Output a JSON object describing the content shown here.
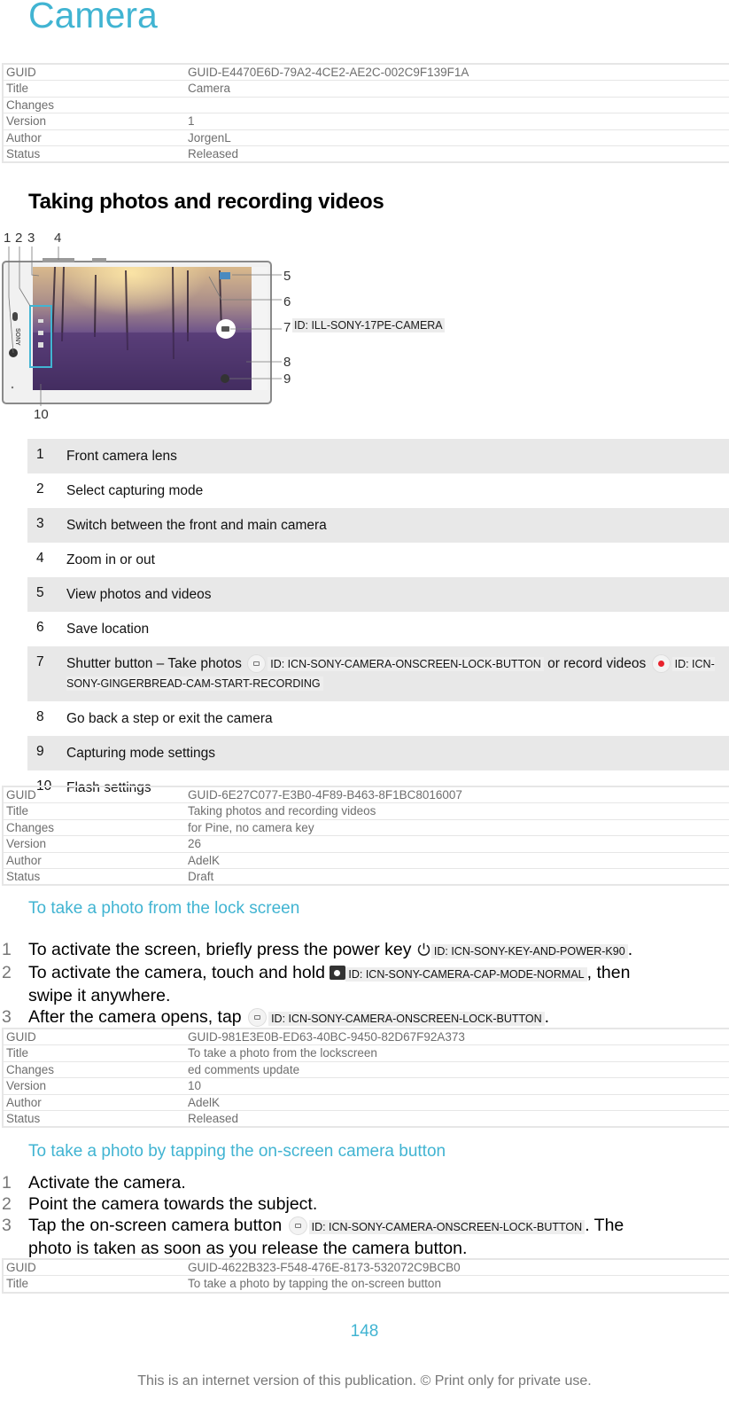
{
  "page_title": "Camera",
  "meta_tables": [
    {
      "rows": [
        {
          "key": "GUID",
          "value": "GUID-E4470E6D-79A2-4CE2-AE2C-002C9F139F1A"
        },
        {
          "key": "Title",
          "value": "Camera"
        },
        {
          "key": "Changes",
          "value": ""
        },
        {
          "key": "Version",
          "value": "1"
        },
        {
          "key": "Author",
          "value": "JorgenL"
        },
        {
          "key": "Status",
          "value": "Released"
        }
      ]
    },
    {
      "rows": [
        {
          "key": "GUID",
          "value": "GUID-6E27C077-E3B0-4F89-B463-8F1BC8016007"
        },
        {
          "key": "Title",
          "value": "Taking photos and recording videos"
        },
        {
          "key": "Changes",
          "value": "for Pine, no camera key"
        },
        {
          "key": "Version",
          "value": "26"
        },
        {
          "key": "Author",
          "value": "AdelK"
        },
        {
          "key": "Status",
          "value": "Draft"
        }
      ]
    },
    {
      "rows": [
        {
          "key": "GUID",
          "value": "GUID-981E3E0B-ED63-40BC-9450-82D67F92A373"
        },
        {
          "key": "Title",
          "value": "To take a photo from the lockscreen"
        },
        {
          "key": "Changes",
          "value": "ed comments update"
        },
        {
          "key": "Version",
          "value": "10"
        },
        {
          "key": "Author",
          "value": "AdelK"
        },
        {
          "key": "Status",
          "value": "Released"
        }
      ]
    },
    {
      "rows": [
        {
          "key": "GUID",
          "value": "GUID-4622B323-F548-476E-8173-532072C9BCB0"
        },
        {
          "key": "Title",
          "value": "To take a photo by tapping the on-screen button"
        }
      ]
    }
  ],
  "section_heading": "Taking photos and recording videos",
  "illustration": {
    "id_label": "ID: ILL-SONY-17PE-CAMERA",
    "brand": "SONY",
    "callout_numbers": [
      "1",
      "2",
      "3",
      "4",
      "5",
      "6",
      "7",
      "8",
      "9",
      "10"
    ]
  },
  "callouts": [
    {
      "num": "1",
      "text": "Front camera lens"
    },
    {
      "num": "2",
      "text": "Select capturing mode"
    },
    {
      "num": "3",
      "text": "Switch between the front and main camera"
    },
    {
      "num": "4",
      "text": "Zoom in or out"
    },
    {
      "num": "5",
      "text": "View photos and videos"
    },
    {
      "num": "6",
      "text": "Save location"
    },
    {
      "num": "7",
      "text_a": "Shutter button – Take photos",
      "icon_a_id": "ID: ICN-SONY-CAMERA-ONSCREEN-LOCK-BUTTON",
      "text_b": "or record videos",
      "icon_b_id": "ID: ICN-SONY-GINGERBREAD-CAM-START-RECORDING"
    },
    {
      "num": "8",
      "text": "Go back a step or exit the camera"
    },
    {
      "num": "9",
      "text": "Capturing mode settings"
    },
    {
      "num": "10",
      "text": "Flash settings"
    }
  ],
  "procedure_lock_screen": {
    "heading": "To take a photo from the lock screen",
    "steps": [
      {
        "num": "1",
        "text_a": "To activate the screen, briefly press the power key",
        "icon_id": "ID: ICN-SONY-KEY-AND-POWER-K90",
        "text_b": "."
      },
      {
        "num": "2",
        "text_a": "To activate the camera, touch and hold",
        "icon_id": "ID: ICN-SONY-CAMERA-CAP-MODE-NORMAL",
        "text_b": ", then swipe it anywhere."
      },
      {
        "num": "3",
        "text_a": "After the camera opens, tap",
        "icon_id": "ID: ICN-SONY-CAMERA-ONSCREEN-LOCK-BUTTON",
        "text_b": "."
      }
    ]
  },
  "procedure_onscreen": {
    "heading": "To take a photo by tapping the on-screen camera button",
    "steps": [
      {
        "num": "1",
        "text": "Activate the camera."
      },
      {
        "num": "2",
        "text": "Point the camera towards the subject."
      },
      {
        "num": "3",
        "text_a": "Tap the on-screen camera button",
        "icon_id": "ID: ICN-SONY-CAMERA-ONSCREEN-LOCK-BUTTON",
        "text_b": ". The photo is taken as soon as you release the camera button."
      }
    ]
  },
  "page_number": "148",
  "footer": "This is an internet version of this publication. © Print only for private use.",
  "colors": {
    "accent": "#41b4d2",
    "meta_text": "#6e6e6e",
    "row_shade": "#e8e8e8",
    "record_red": "#e8222c"
  }
}
